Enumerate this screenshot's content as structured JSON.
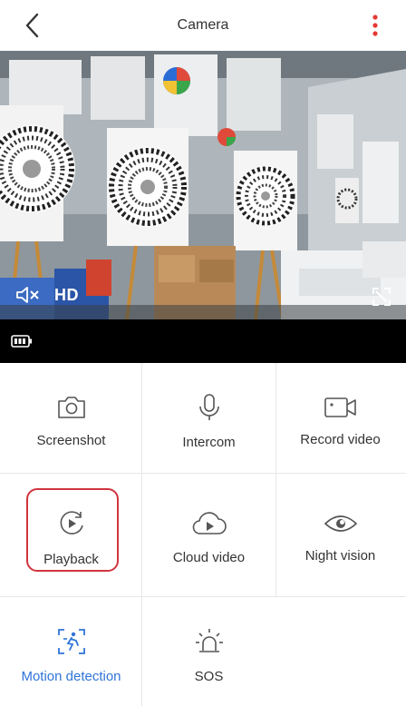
{
  "header": {
    "title": "Camera",
    "back_icon": "chevron-left-icon",
    "more_icon": "vertical-dots-icon",
    "more_color": "#e53935"
  },
  "video": {
    "quality_label": "HD",
    "mute_icon": "speaker-muted-icon",
    "fullscreen_icon": "fullscreen-icon"
  },
  "status": {
    "battery_icon": "battery-icon"
  },
  "controls": [
    {
      "label": "Screenshot",
      "icon": "camera-icon"
    },
    {
      "label": "Intercom",
      "icon": "microphone-icon"
    },
    {
      "label": "Record video",
      "icon": "video-camera-icon"
    },
    {
      "label": "Playback",
      "icon": "playback-icon"
    },
    {
      "label": "Cloud video",
      "icon": "cloud-play-icon"
    },
    {
      "label": "Night vision",
      "icon": "eye-icon"
    },
    {
      "label": "Motion detection",
      "icon": "motion-icon",
      "active": true
    },
    {
      "label": "SOS",
      "icon": "alarm-icon"
    }
  ],
  "accent_color": "#2f74d9",
  "highlight_color": "#d0343f"
}
